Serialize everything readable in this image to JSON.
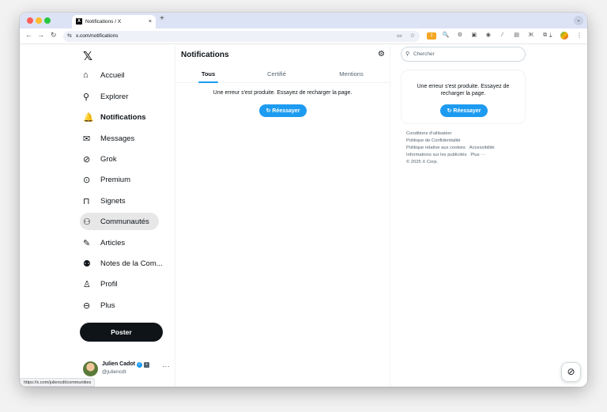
{
  "browser": {
    "tab_title": "Notifications / X",
    "tab_favicon": "x-logo-icon",
    "new_tab": "+",
    "close": "×",
    "url": "x.com/notifications",
    "status_url": "https://x.com/juliencdt/communities"
  },
  "sidebar": {
    "logo": "𝕏",
    "items": [
      {
        "label": "Accueil",
        "icon": "home-icon",
        "glyph": "⌂"
      },
      {
        "label": "Explorer",
        "icon": "search-icon",
        "glyph": "⚲"
      },
      {
        "label": "Notifications",
        "icon": "bell-icon",
        "glyph": "🔔"
      },
      {
        "label": "Messages",
        "icon": "envelope-icon",
        "glyph": "✉"
      },
      {
        "label": "Grok",
        "icon": "grok-icon",
        "glyph": "⊘"
      },
      {
        "label": "Premium",
        "icon": "premium-icon",
        "glyph": "⊙"
      },
      {
        "label": "Signets",
        "icon": "bookmark-icon",
        "glyph": "⊓"
      },
      {
        "label": "Communautés",
        "icon": "communities-icon",
        "glyph": "⚇"
      },
      {
        "label": "Articles",
        "icon": "articles-icon",
        "glyph": "✎"
      },
      {
        "label": "Notes de la Com...",
        "icon": "community-notes-icon",
        "glyph": "⚉"
      },
      {
        "label": "Profil",
        "icon": "profile-icon",
        "glyph": "♙"
      },
      {
        "label": "Plus",
        "icon": "more-circle-icon",
        "glyph": "⊖"
      }
    ],
    "post_label": "Poster",
    "profile": {
      "name": "Julien Cadot",
      "handle": "@juliencdt",
      "more": "···"
    }
  },
  "main": {
    "title": "Notifications",
    "tabs": [
      {
        "label": "Tous"
      },
      {
        "label": "Certifié"
      },
      {
        "label": "Mentions"
      }
    ],
    "error_message": "Une erreur s'est produite. Essayez de recharger la page.",
    "retry_label": "Réessayer"
  },
  "right": {
    "search_placeholder": "Chercher",
    "error_message": "Une erreur s'est produite. Essayez de recharger la page.",
    "retry_label": "Réessayer",
    "footer": {
      "terms": "Conditions d'utilisation",
      "privacy": "Politique de Confidentialité",
      "cookies": "Politique relative aux cookies",
      "accessibility": "Accessibilité",
      "ads": "Informations sur les publicités",
      "more": "Plus ···",
      "copyright": "© 2025 X Corp."
    }
  },
  "colors": {
    "accent": "#1d9bf0",
    "text": "#0f1419",
    "muted": "#536471"
  }
}
